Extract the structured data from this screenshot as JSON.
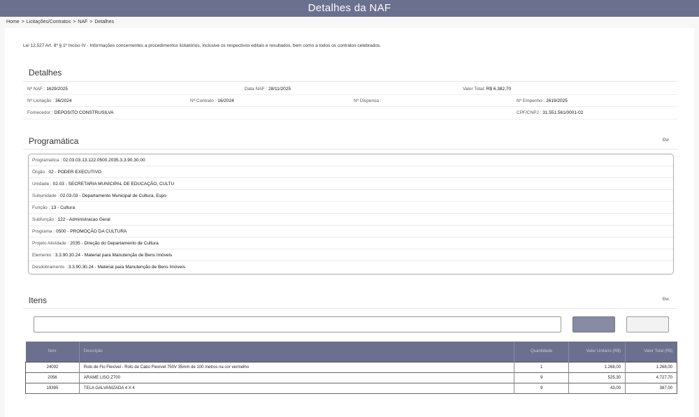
{
  "header": {
    "title": "Detalhes  da NAF"
  },
  "breadcrumb": {
    "home": "Home",
    "licitacoes": "Licitações/Contratos",
    "naf": "NAF",
    "detalhes": "Detalhes",
    "sep": ">"
  },
  "law_text": "Lei 12.527 Art. 8º § 1º Inciso IV - Informações concernentes a procedimentos licitatórios, inclusive os respectivos editais e resultados, bem como a todos os contratos celebrados.",
  "detalhes": {
    "title": "Detalhes",
    "naf_label": "Nº NAF :",
    "naf_value": "1629/2025",
    "data_label": "Data NAF :",
    "data_value": "28/11/2025",
    "valor_label": "Valor Total:",
    "valor_value": "R$ 6.382,70",
    "licitacao_label": "Nº Licitação :",
    "licitacao_value": "36/2024",
    "contrato_label": "Nº Contrato :",
    "contrato_value": "16/2024",
    "dispensa_label": "Nº Dispensa :",
    "dispensa_value": "",
    "empenho_label": "Nº Empenho :",
    "empenho_value": "2619/2025",
    "fornecedor_label": "Fornecedor :",
    "fornecedor_value": "DEPOSITO CONSTRUSILVA",
    "cpf_label": "CPF/CNPJ :",
    "cpf_value": "31.551.561/0001-02"
  },
  "programatica": {
    "title": "Programática",
    "edit": "Ðw",
    "rows": [
      {
        "label": "Programática :",
        "value": "02.03.03.13.122.0500.2035.3.3.90.30.00"
      },
      {
        "label": "Órgão :",
        "value": "02 - PODER EXECUTIVO"
      },
      {
        "label": "Unidade :",
        "value": "02.03 - SECRETARIA MUNICIPAL DE EDUCAÇÃO, CULTU"
      },
      {
        "label": "Subunidade :",
        "value": "02.03.03 - Departamento Municipal de Cultura, Espo"
      },
      {
        "label": "Função :",
        "value": "13 - Cultura"
      },
      {
        "label": "Subfunção :",
        "value": "122 - Administracao Geral"
      },
      {
        "label": "Programa :",
        "value": "0500 - PROMOÇÃO DA CULTURA"
      },
      {
        "label": "Projeto Atividade :",
        "value": "2035 - Direção do Departamento de Cultura"
      },
      {
        "label": "Elemento :",
        "value": "3.3.90.30.24 - Material para Manutenção de Bens Imóveis"
      },
      {
        "label": "Desdobramento :",
        "value": "3.3.90.30.24 - Material para Manutenção de Bens Imóveis"
      }
    ]
  },
  "itens": {
    "title": "Itens",
    "edit": "Ðw",
    "search": {
      "value": "",
      "placeholder": ""
    },
    "columns": [
      "Item",
      "Descrição",
      "Quantidade",
      "Valor Unitário (R$)",
      "Valor Total (R$)"
    ],
    "rows": [
      {
        "item": "24092",
        "descricao": "Rolo de Fio Flexível - Rolo de Cabo Flexível 750V 35mm de 100 metros na cor vermelho",
        "quantidade": "1",
        "unitario": "1.268,00",
        "total": "1.268,00"
      },
      {
        "item": "2056",
        "descricao": "ARAME LISO Z700",
        "quantidade": "9",
        "unitario": "525,30",
        "total": "4.727,70"
      },
      {
        "item": "19395",
        "descricao": "TELA GALVANIZADA 4 X 4",
        "quantidade": "9",
        "unitario": "43,00",
        "total": "387,00"
      }
    ]
  }
}
